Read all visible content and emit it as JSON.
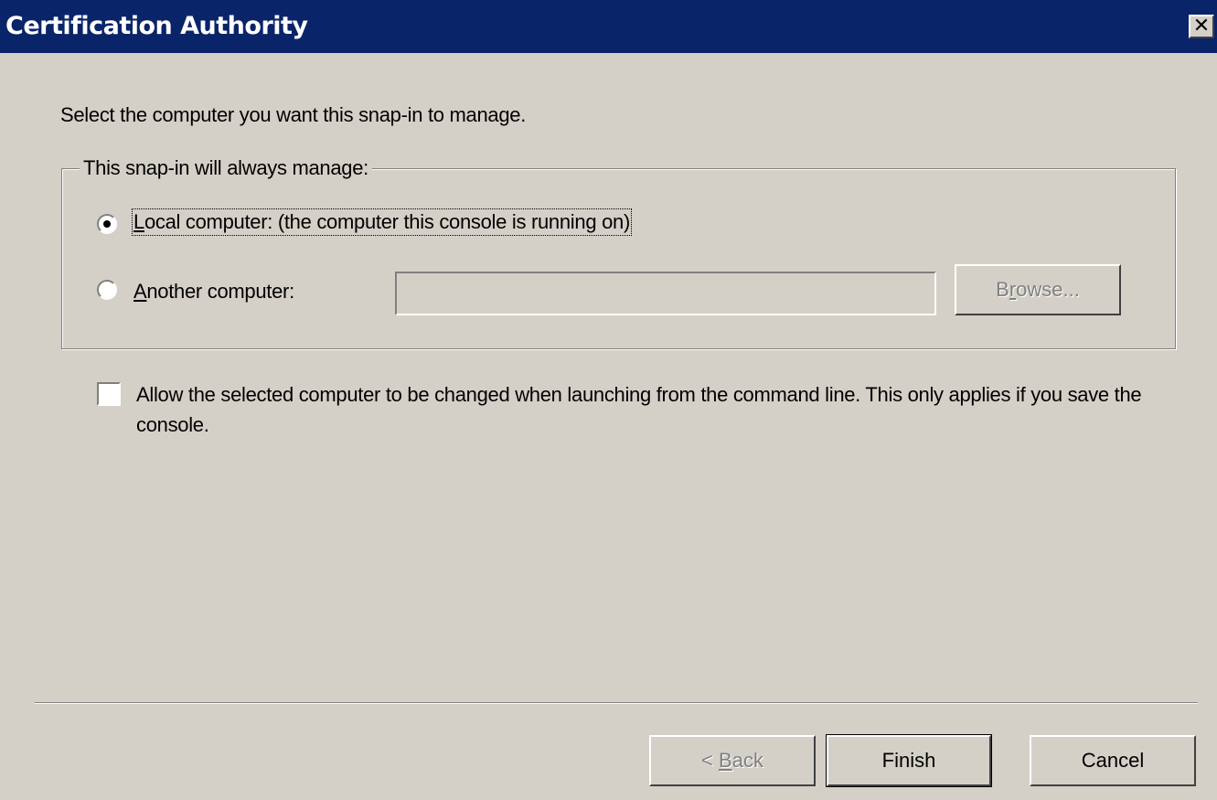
{
  "window": {
    "title": "Certification Authority",
    "close_glyph": "✕"
  },
  "instruction": "Select the computer you want this snap-in to manage.",
  "group": {
    "legend": "This snap-in will always manage:",
    "local_option": {
      "accel": "L",
      "rest": "ocal computer:  (the computer this console is running on)",
      "selected": true
    },
    "another_option": {
      "accel": "A",
      "rest": "nother computer:",
      "selected": false
    },
    "computer_name_value": "",
    "browse_button": {
      "pre": "B",
      "accel": "r",
      "post": "owse...",
      "enabled": false
    }
  },
  "checkbox": {
    "label": "Allow the selected computer to be changed when launching from the command line. This only applies if you save the console.",
    "checked": false
  },
  "footer": {
    "back_button": {
      "pre": "< ",
      "accel": "B",
      "post": "ack",
      "enabled": false
    },
    "finish_label": "Finish",
    "cancel_label": "Cancel"
  },
  "colors": {
    "titlebar": "#0a246a",
    "dialog_background": "#d4d0c8"
  }
}
